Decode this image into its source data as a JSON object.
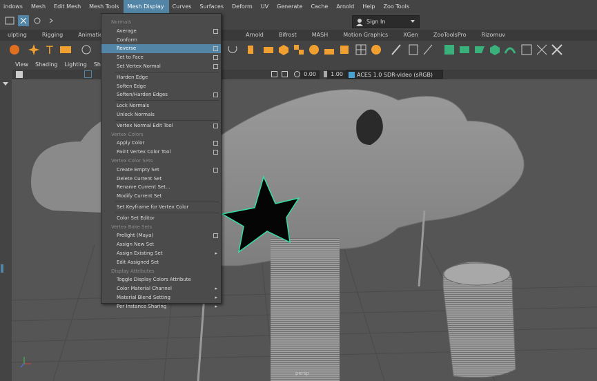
{
  "menubar": {
    "items": [
      "indows",
      "Mesh",
      "Edit Mesh",
      "Mesh Tools",
      "Mesh Display",
      "Curves",
      "Surfaces",
      "Deform",
      "UV",
      "Generate",
      "Cache",
      "Arnold",
      "Help",
      "Zoo Tools"
    ],
    "active": "Mesh Display"
  },
  "statusline": {
    "sign_in": "Sign In"
  },
  "shelf_tabs": [
    "ulpting",
    "Rigging",
    "Animation",
    "",
    "",
    "",
    "Arnold",
    "Bifrost",
    "MASH",
    "Motion Graphics",
    "XGen",
    "ZooToolsPro",
    "Rizomuv"
  ],
  "viewport_menu": [
    "View",
    "Shading",
    "Lighting",
    "Show"
  ],
  "viewport_toolbar": {
    "value_a": "0.00",
    "value_b": "1.00",
    "color_space": "ACES 1.0 SDR-video (sRGB)"
  },
  "viewport": {
    "camera_label": "persp"
  },
  "dropdown": {
    "rows": [
      {
        "label": "Normals",
        "type": "section"
      },
      {
        "label": "Average",
        "box": true
      },
      {
        "label": "Conform"
      },
      {
        "label": "Reverse",
        "box": true,
        "highlight": true
      },
      {
        "label": "Set to Face",
        "box": true
      },
      {
        "label": "Set Vertex Normal",
        "box": true
      },
      {
        "type": "sep"
      },
      {
        "label": "Harden Edge"
      },
      {
        "label": "Soften Edge"
      },
      {
        "label": "Soften/Harden Edges",
        "box": true
      },
      {
        "type": "sep"
      },
      {
        "label": "Lock Normals"
      },
      {
        "label": "Unlock Normals"
      },
      {
        "type": "sep"
      },
      {
        "label": "Vertex Normal Edit Tool",
        "box": true
      },
      {
        "label": "Vertex Colors",
        "type": "section"
      },
      {
        "label": "Apply Color",
        "box": true
      },
      {
        "label": "Paint Vertex Color Tool",
        "box": true
      },
      {
        "label": "Vertex Color Sets",
        "type": "section"
      },
      {
        "label": "Create Empty Set",
        "box": true
      },
      {
        "label": "Delete Current Set"
      },
      {
        "label": "Rename Current Set..."
      },
      {
        "label": "Modify Current Set"
      },
      {
        "type": "sep"
      },
      {
        "label": "Set Keyframe for Vertex Color"
      },
      {
        "type": "sep"
      },
      {
        "label": "Color Set Editor"
      },
      {
        "label": "Vertex Bake Sets",
        "type": "section"
      },
      {
        "label": "Prelight (Maya)",
        "box": true
      },
      {
        "label": "Assign New Set"
      },
      {
        "label": "Assign Existing Set",
        "arrow": true
      },
      {
        "label": "Edit Assigned Set"
      },
      {
        "label": "Display Attributes",
        "type": "section"
      },
      {
        "label": "Toggle Display Colors Attribute"
      },
      {
        "label": "Color Material Channel",
        "arrow": true
      },
      {
        "label": "Material Blend Setting",
        "arrow": true
      },
      {
        "label": "Per Instance Sharing",
        "arrow": true
      }
    ]
  }
}
